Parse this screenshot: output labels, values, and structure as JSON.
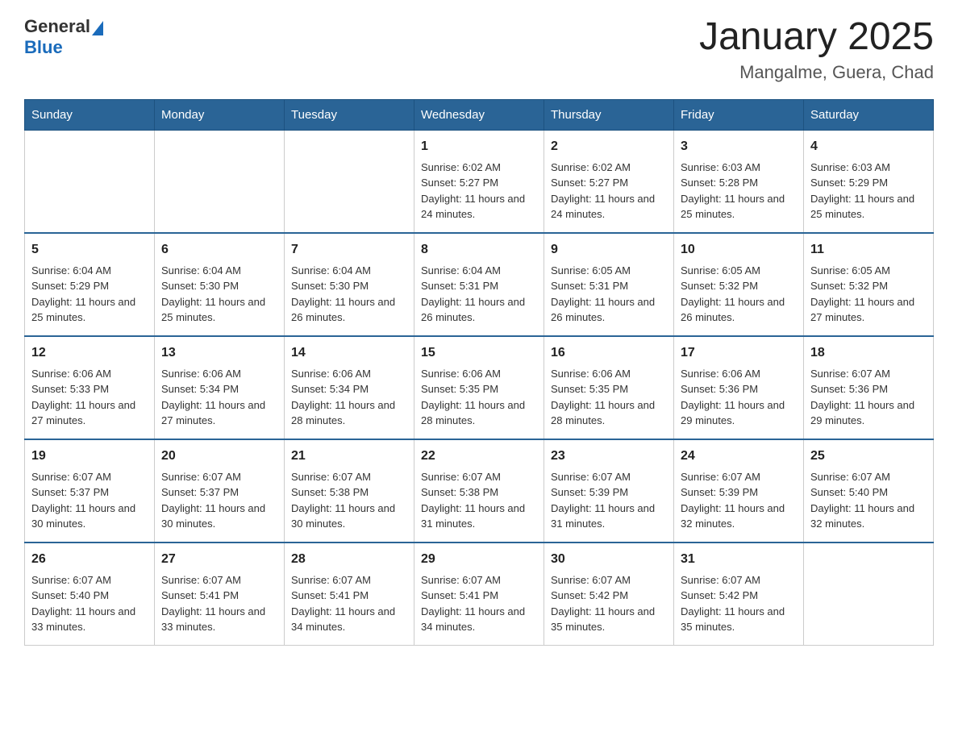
{
  "header": {
    "logo_general": "General",
    "logo_blue": "Blue",
    "title": "January 2025",
    "location": "Mangalme, Guera, Chad"
  },
  "days_of_week": [
    "Sunday",
    "Monday",
    "Tuesday",
    "Wednesday",
    "Thursday",
    "Friday",
    "Saturday"
  ],
  "weeks": [
    [
      {
        "day": "",
        "info": ""
      },
      {
        "day": "",
        "info": ""
      },
      {
        "day": "",
        "info": ""
      },
      {
        "day": "1",
        "info": "Sunrise: 6:02 AM\nSunset: 5:27 PM\nDaylight: 11 hours and 24 minutes."
      },
      {
        "day": "2",
        "info": "Sunrise: 6:02 AM\nSunset: 5:27 PM\nDaylight: 11 hours and 24 minutes."
      },
      {
        "day": "3",
        "info": "Sunrise: 6:03 AM\nSunset: 5:28 PM\nDaylight: 11 hours and 25 minutes."
      },
      {
        "day": "4",
        "info": "Sunrise: 6:03 AM\nSunset: 5:29 PM\nDaylight: 11 hours and 25 minutes."
      }
    ],
    [
      {
        "day": "5",
        "info": "Sunrise: 6:04 AM\nSunset: 5:29 PM\nDaylight: 11 hours and 25 minutes."
      },
      {
        "day": "6",
        "info": "Sunrise: 6:04 AM\nSunset: 5:30 PM\nDaylight: 11 hours and 25 minutes."
      },
      {
        "day": "7",
        "info": "Sunrise: 6:04 AM\nSunset: 5:30 PM\nDaylight: 11 hours and 26 minutes."
      },
      {
        "day": "8",
        "info": "Sunrise: 6:04 AM\nSunset: 5:31 PM\nDaylight: 11 hours and 26 minutes."
      },
      {
        "day": "9",
        "info": "Sunrise: 6:05 AM\nSunset: 5:31 PM\nDaylight: 11 hours and 26 minutes."
      },
      {
        "day": "10",
        "info": "Sunrise: 6:05 AM\nSunset: 5:32 PM\nDaylight: 11 hours and 26 minutes."
      },
      {
        "day": "11",
        "info": "Sunrise: 6:05 AM\nSunset: 5:32 PM\nDaylight: 11 hours and 27 minutes."
      }
    ],
    [
      {
        "day": "12",
        "info": "Sunrise: 6:06 AM\nSunset: 5:33 PM\nDaylight: 11 hours and 27 minutes."
      },
      {
        "day": "13",
        "info": "Sunrise: 6:06 AM\nSunset: 5:34 PM\nDaylight: 11 hours and 27 minutes."
      },
      {
        "day": "14",
        "info": "Sunrise: 6:06 AM\nSunset: 5:34 PM\nDaylight: 11 hours and 28 minutes."
      },
      {
        "day": "15",
        "info": "Sunrise: 6:06 AM\nSunset: 5:35 PM\nDaylight: 11 hours and 28 minutes."
      },
      {
        "day": "16",
        "info": "Sunrise: 6:06 AM\nSunset: 5:35 PM\nDaylight: 11 hours and 28 minutes."
      },
      {
        "day": "17",
        "info": "Sunrise: 6:06 AM\nSunset: 5:36 PM\nDaylight: 11 hours and 29 minutes."
      },
      {
        "day": "18",
        "info": "Sunrise: 6:07 AM\nSunset: 5:36 PM\nDaylight: 11 hours and 29 minutes."
      }
    ],
    [
      {
        "day": "19",
        "info": "Sunrise: 6:07 AM\nSunset: 5:37 PM\nDaylight: 11 hours and 30 minutes."
      },
      {
        "day": "20",
        "info": "Sunrise: 6:07 AM\nSunset: 5:37 PM\nDaylight: 11 hours and 30 minutes."
      },
      {
        "day": "21",
        "info": "Sunrise: 6:07 AM\nSunset: 5:38 PM\nDaylight: 11 hours and 30 minutes."
      },
      {
        "day": "22",
        "info": "Sunrise: 6:07 AM\nSunset: 5:38 PM\nDaylight: 11 hours and 31 minutes."
      },
      {
        "day": "23",
        "info": "Sunrise: 6:07 AM\nSunset: 5:39 PM\nDaylight: 11 hours and 31 minutes."
      },
      {
        "day": "24",
        "info": "Sunrise: 6:07 AM\nSunset: 5:39 PM\nDaylight: 11 hours and 32 minutes."
      },
      {
        "day": "25",
        "info": "Sunrise: 6:07 AM\nSunset: 5:40 PM\nDaylight: 11 hours and 32 minutes."
      }
    ],
    [
      {
        "day": "26",
        "info": "Sunrise: 6:07 AM\nSunset: 5:40 PM\nDaylight: 11 hours and 33 minutes."
      },
      {
        "day": "27",
        "info": "Sunrise: 6:07 AM\nSunset: 5:41 PM\nDaylight: 11 hours and 33 minutes."
      },
      {
        "day": "28",
        "info": "Sunrise: 6:07 AM\nSunset: 5:41 PM\nDaylight: 11 hours and 34 minutes."
      },
      {
        "day": "29",
        "info": "Sunrise: 6:07 AM\nSunset: 5:41 PM\nDaylight: 11 hours and 34 minutes."
      },
      {
        "day": "30",
        "info": "Sunrise: 6:07 AM\nSunset: 5:42 PM\nDaylight: 11 hours and 35 minutes."
      },
      {
        "day": "31",
        "info": "Sunrise: 6:07 AM\nSunset: 5:42 PM\nDaylight: 11 hours and 35 minutes."
      },
      {
        "day": "",
        "info": ""
      }
    ]
  ]
}
